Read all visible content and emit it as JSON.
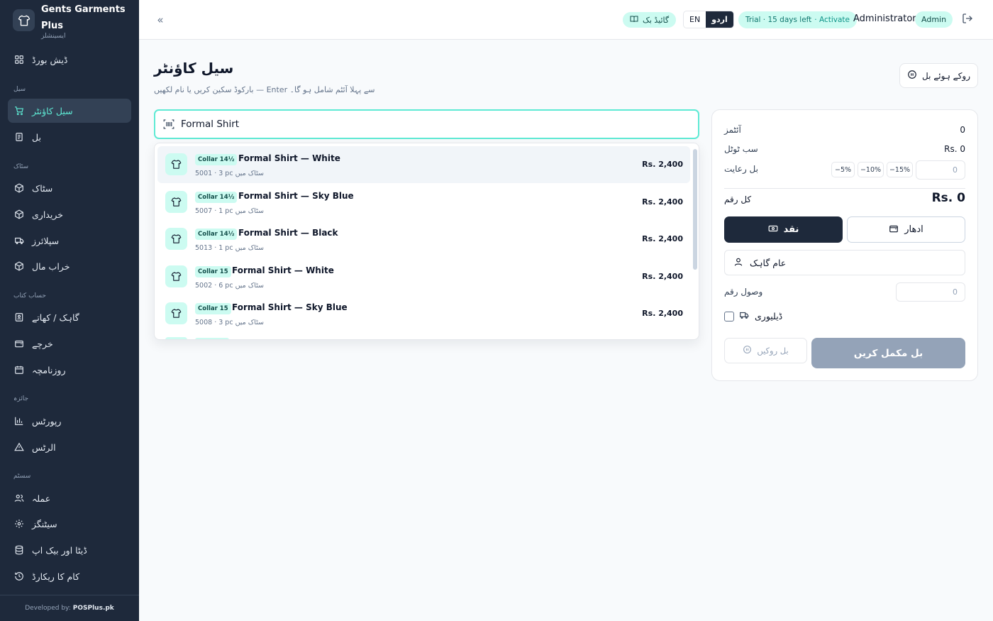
{
  "brand": {
    "name": "Gents Garments Plus",
    "subtitle": "ایسینشلز"
  },
  "sidebar": {
    "dashboard": "ڈیش بورڈ",
    "sections": {
      "sale": "سیل",
      "stock": "سٹاک",
      "accounts": "حساب کتاب",
      "review": "جائزہ",
      "system": "سسٹم"
    },
    "items": {
      "sale_counter": "سیل کاؤنٹر",
      "bills": "بل",
      "stock": "سٹاک",
      "purchases": "خریداری",
      "suppliers": "سپلائرز",
      "damaged": "خراب مال",
      "customers": "گاہک / کھاتے",
      "expenses": "خرچے",
      "daybook": "روزنامچہ",
      "reports": "رپورٹس",
      "alerts": "الرٹس",
      "staff": "عملہ",
      "settings": "سیٹنگز",
      "data_backup": "ڈیٹا اور بیک اپ",
      "activity_log": "کام کا ریکارڈ"
    },
    "footer_prefix": "Developed by:",
    "footer_brand": "POSPlus.pk"
  },
  "header": {
    "guide": "گائیڈ بک",
    "lang_en": "EN",
    "lang_ur": "اردو",
    "trial": "Trial · 15 days left",
    "activate": "· Activate",
    "user": "Administrator",
    "role": "Admin"
  },
  "page": {
    "title": "سیل کاؤنٹر",
    "subtitle": "بارکوڈ سکین کریں یا نام لکھیں — Enter سے پہلا آئٹم شامل ہو گا۔",
    "held_bills": "روکے ہوئے بل"
  },
  "search": {
    "value": "Formal Shirt"
  },
  "results": [
    {
      "tag": "Collar 14½",
      "name": "Formal Shirt — White",
      "meta": "5001 · 3 pc سٹاک میں",
      "price": "Rs. 2,400"
    },
    {
      "tag": "Collar 14½",
      "name": "Formal Shirt — Sky Blue",
      "meta": "5007 · 1 pc سٹاک میں",
      "price": "Rs. 2,400"
    },
    {
      "tag": "Collar 14½",
      "name": "Formal Shirt — Black",
      "meta": "5013 · 1 pc سٹاک میں",
      "price": "Rs. 2,400"
    },
    {
      "tag": "Collar 15",
      "name": "Formal Shirt — White",
      "meta": "5002 · 6 pc سٹاک میں",
      "price": "Rs. 2,400"
    },
    {
      "tag": "Collar 15",
      "name": "Formal Shirt — Sky Blue",
      "meta": "5008 · 3 pc سٹاک میں",
      "price": "Rs. 2,400"
    }
  ],
  "summary": {
    "items_label": "آئٹمز",
    "items_value": "0",
    "subtotal_label": "سب ٹوٹل",
    "subtotal_value": "Rs. 0",
    "discount_label": "بل رعایت",
    "discount_options": [
      "−5%",
      "−10%",
      "−15%"
    ],
    "discount_value": "0",
    "total_label": "کل رقم",
    "total_value": "Rs. 0",
    "cash": "نقد",
    "credit": "ادھار",
    "customer": "عام گاہک",
    "received_label": "وصول رقم",
    "received_value": "0",
    "delivery": "ڈیلیوری",
    "hold": "بل روکیں",
    "complete": "بل مکمل کریں"
  }
}
